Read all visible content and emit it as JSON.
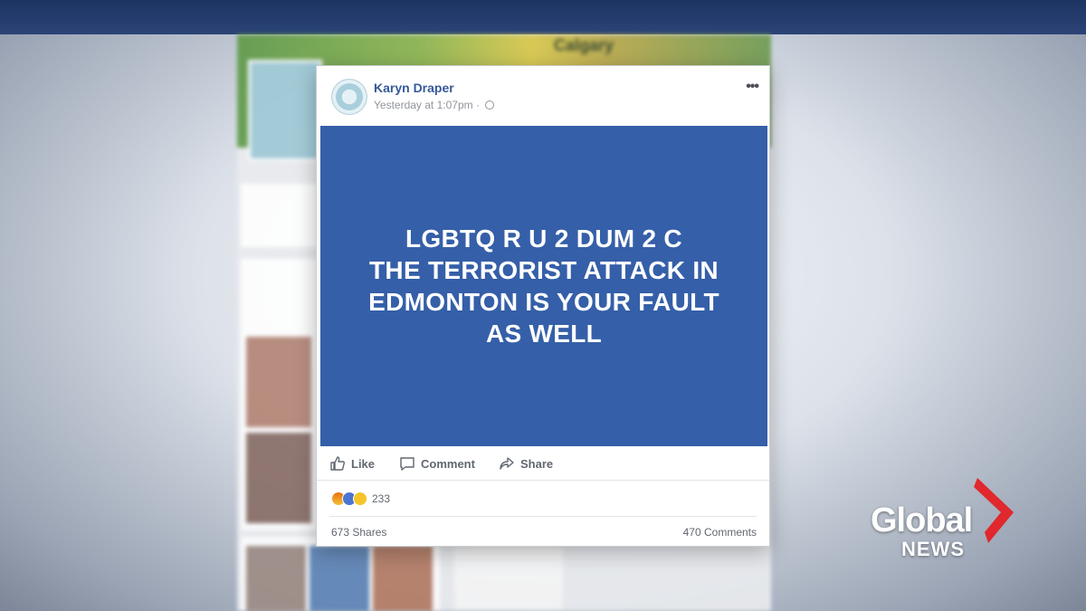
{
  "background": {
    "cover_label": "Calgary"
  },
  "post": {
    "author": "Karyn Draper",
    "timestamp": "Yesterday at 1:07pm",
    "separator": "·",
    "privacy_icon": "globe-icon",
    "more_label": "•••",
    "image_text_lines": [
      "LGBTQ R U 2 DUM 2 C",
      "THE TERRORIST ATTACK IN",
      "EDMONTON IS YOUR FAULT",
      "AS WELL"
    ],
    "image_background": "#355fa8",
    "actions": {
      "like": "Like",
      "comment": "Comment",
      "share": "Share"
    },
    "reactions": {
      "icons": [
        "angry-icon",
        "like-icon",
        "haha-icon"
      ],
      "count": "233"
    },
    "shares": "673 Shares",
    "comments": "470 Comments"
  },
  "logo": {
    "line1": "Global",
    "line2": "NEWS",
    "accent": "#e0282e"
  }
}
